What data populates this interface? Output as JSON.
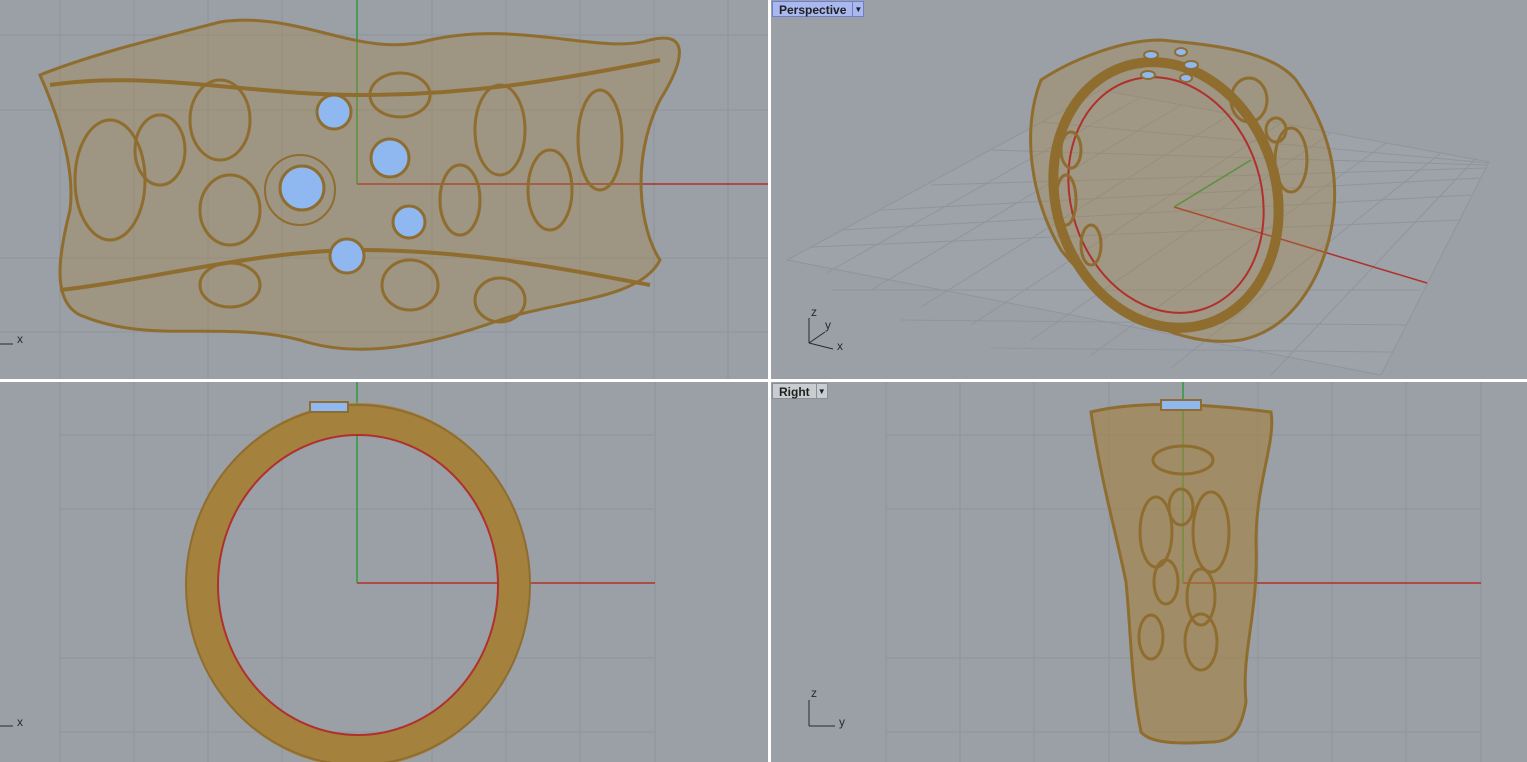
{
  "viewports": {
    "top": {
      "axis_h": "x"
    },
    "perspective": {
      "title": "Perspective",
      "axis_x": "x",
      "axis_y": "y",
      "axis_z": "z"
    },
    "front": {
      "axis_h": "x"
    },
    "right": {
      "title": "Right",
      "axis_h": "y",
      "axis_v": "z"
    }
  },
  "colors": {
    "viewport_bg": "#9aa0a6",
    "grid_minor": "#8f959b",
    "grid_major": "#7f858b",
    "axis_x": "#b0302c",
    "axis_y": "#2e9b3a",
    "wire": "#8f6d2f",
    "wire_fill": "#a5813e",
    "gem": "#8fb8f0"
  }
}
